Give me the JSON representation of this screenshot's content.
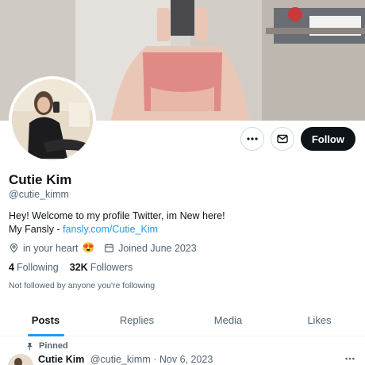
{
  "profile": {
    "display_name": "Cutie Kim",
    "handle": "@cutie_kimm",
    "bio_line1": "Hey! Welcome to my profile Twitter, im New here!",
    "bio_line2_prefix": "My Fansly - ",
    "bio_link": "fansly.com/Cutie_Kim",
    "location": "in your heart",
    "location_emoji": "😍",
    "joined": "Joined June 2023",
    "following_count": "4",
    "following_label": "Following",
    "followers_count": "32K",
    "followers_label": "Followers",
    "not_followed_text": "Not followed by anyone you're following"
  },
  "actions": {
    "more_icon": "more-horizontal-icon",
    "message_icon": "envelope-icon",
    "follow_label": "Follow"
  },
  "tabs": [
    {
      "label": "Posts",
      "active": true
    },
    {
      "label": "Replies",
      "active": false
    },
    {
      "label": "Media",
      "active": false
    },
    {
      "label": "Likes",
      "active": false
    }
  ],
  "pinned_post": {
    "pinned_label": "Pinned",
    "author_name": "Cutie Kim",
    "author_handle": "@cutie_kimm",
    "separator": "·",
    "date": "Nov 6, 2023"
  },
  "colors": {
    "accent": "#1d9bf0",
    "text_primary": "#0f1419",
    "text_secondary": "#536471",
    "follow_button": "#0f1419"
  }
}
